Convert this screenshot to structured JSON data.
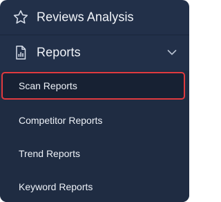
{
  "nav": {
    "reviews_analysis": {
      "label": "Reviews Analysis",
      "icon": "star-icon"
    },
    "reports": {
      "label": "Reports",
      "icon": "report-document-icon",
      "expand_icon": "chevron-down-icon",
      "expanded": true
    }
  },
  "submenu": {
    "items": [
      {
        "label": "Scan Reports",
        "selected": true
      },
      {
        "label": "Competitor Reports",
        "selected": false
      },
      {
        "label": "Trend Reports",
        "selected": false
      },
      {
        "label": "Keyword Reports",
        "selected": false
      }
    ]
  },
  "colors": {
    "panel_bg": "#223049",
    "submenu_bg": "#1f2c42",
    "selected_bg": "#172133",
    "selection_outline": "#e03a3e",
    "text": "#f2f5fa"
  }
}
